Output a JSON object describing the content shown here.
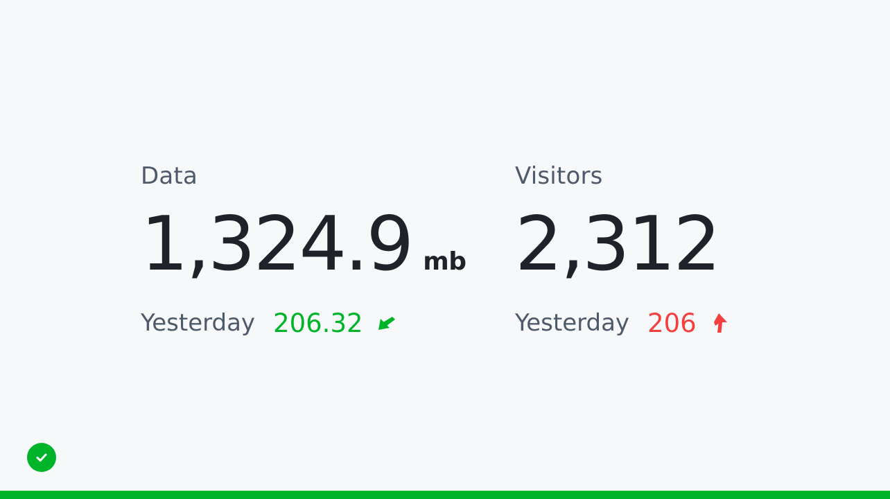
{
  "stats": [
    {
      "title": "Data",
      "value": "1,324.9",
      "unit": "mb",
      "compare_label": "Yesterday",
      "compare_value": "206.32",
      "trend": "up",
      "trend_icon": "arrow-fall-icon",
      "trend_color": "#00b42a"
    },
    {
      "title": "Visitors",
      "value": "2,312",
      "unit": "",
      "compare_label": "Yesterday",
      "compare_value": "206",
      "trend": "down",
      "trend_icon": "arrow-rise-icon",
      "trend_color": "#f53f3f"
    }
  ],
  "status": {
    "icon": "check-circle-icon",
    "color": "#00b42a",
    "progress_percent": 100
  }
}
